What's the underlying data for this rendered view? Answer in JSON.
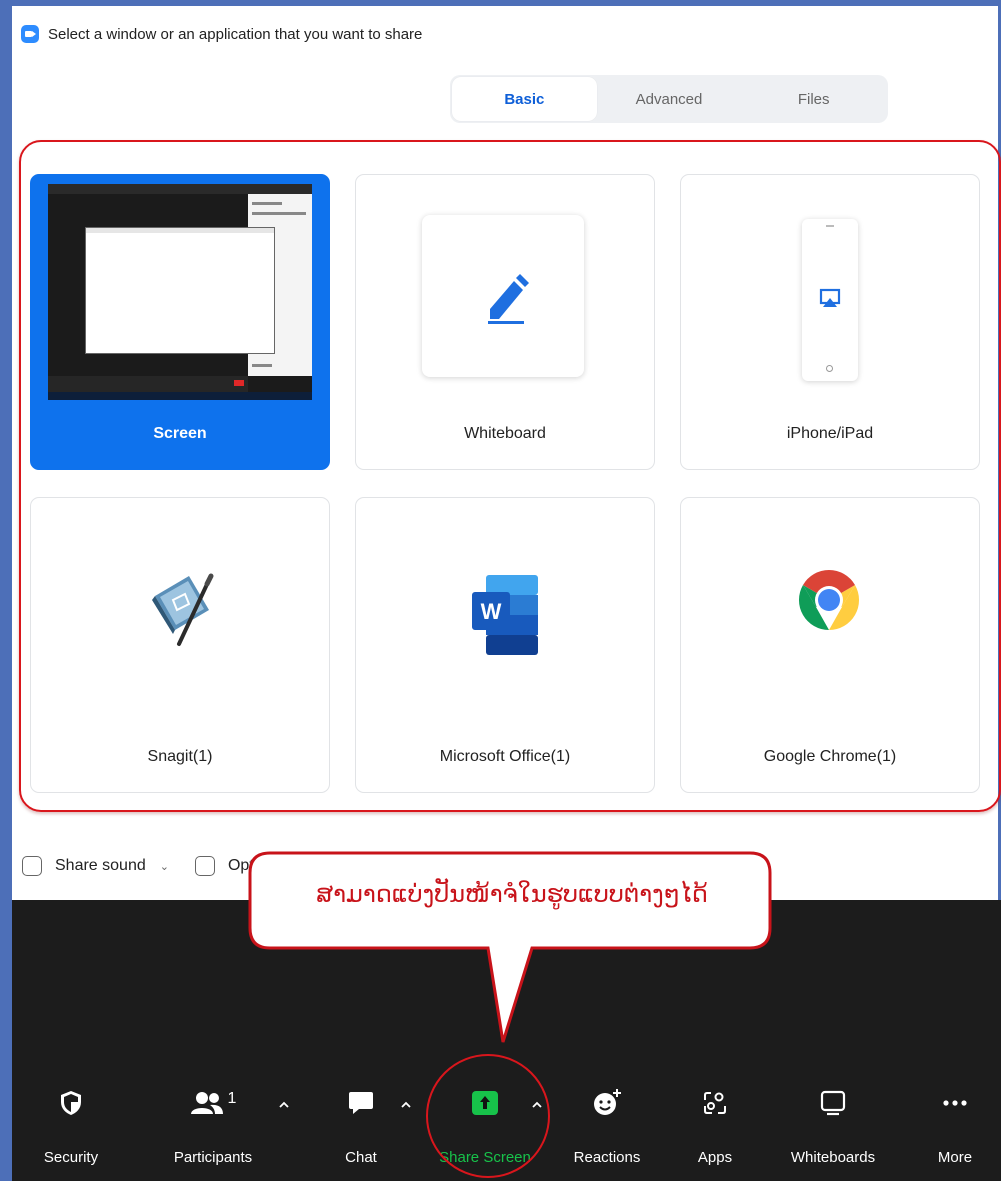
{
  "dialog": {
    "title": "Select a window or an application that you want to share",
    "tabs": [
      {
        "label": "Basic",
        "active": true
      },
      {
        "label": "Advanced",
        "active": false
      },
      {
        "label": "Files",
        "active": false
      }
    ],
    "tiles": [
      {
        "label": "Screen",
        "selected": true,
        "icon": "desktop-screenshot-thumbnail"
      },
      {
        "label": "Whiteboard",
        "selected": false,
        "icon": "pen-icon"
      },
      {
        "label": "iPhone/iPad",
        "selected": false,
        "icon": "airplay-icon"
      },
      {
        "label": "Snagit(1)",
        "selected": false,
        "icon": "snagit-icon"
      },
      {
        "label": "Microsoft Office(1)",
        "selected": false,
        "icon": "word-icon"
      },
      {
        "label": "Google Chrome(1)",
        "selected": false,
        "icon": "chrome-icon"
      }
    ],
    "options": {
      "share_sound": "Share sound",
      "optimize_video": "Optimize for video clip"
    }
  },
  "callout": {
    "text": "ສາມາດແບ່ງປັນໜ້າຈໍໃນຮູບແບບຕ່າງໆໄດ້"
  },
  "toolbar": {
    "items": [
      {
        "label": "Security",
        "icon": "shield-icon"
      },
      {
        "label": "Participants",
        "icon": "participants-icon",
        "count": "1"
      },
      {
        "label": "Chat",
        "icon": "chat-icon"
      },
      {
        "label": "Share Screen",
        "icon": "share-screen-icon",
        "highlighted": true
      },
      {
        "label": "Reactions",
        "icon": "reactions-icon"
      },
      {
        "label": "Apps",
        "icon": "apps-icon"
      },
      {
        "label": "Whiteboards",
        "icon": "whiteboards-icon"
      },
      {
        "label": "More",
        "icon": "more-icon"
      }
    ]
  },
  "colors": {
    "accent_blue": "#0e72ed",
    "selected_tab_text": "#0e5fd8",
    "annotation_red": "#d9161c",
    "share_green": "#17c24a",
    "meeting_bar_bg": "#1c1c1c",
    "frame_blue": "#4d6fb8"
  }
}
